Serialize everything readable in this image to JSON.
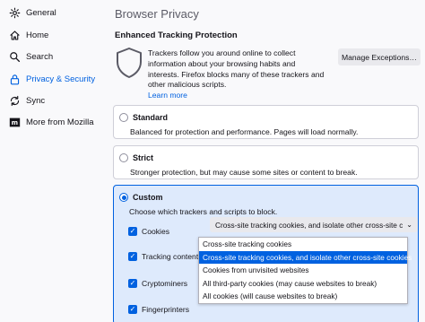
{
  "sidebar": {
    "items": [
      {
        "label": "General",
        "icon": "gear-icon"
      },
      {
        "label": "Home",
        "icon": "home-icon"
      },
      {
        "label": "Search",
        "icon": "search-icon"
      },
      {
        "label": "Privacy & Security",
        "icon": "lock-icon",
        "active": true
      },
      {
        "label": "Sync",
        "icon": "sync-icon"
      },
      {
        "label": "More from Mozilla",
        "icon": "mozilla-icon"
      }
    ]
  },
  "main": {
    "page_title": "Browser Privacy",
    "section_title": "Enhanced Tracking Protection",
    "etp_description": "Trackers follow you around online to collect information about your browsing habits and interests. Firefox blocks many of these trackers and other malicious scripts.",
    "learn_more": "Learn more",
    "manage_exceptions": "Manage Exceptions…"
  },
  "options": {
    "standard": {
      "label": "Standard",
      "description": "Balanced for protection and performance. Pages will load normally."
    },
    "strict": {
      "label": "Strict",
      "description": "Stronger protection, but may cause some sites or content to break."
    },
    "custom": {
      "label": "Custom",
      "description": "Choose which trackers and scripts to block.",
      "checks": [
        {
          "label": "Cookies",
          "checked": true
        },
        {
          "label": "Tracking content",
          "checked": true
        },
        {
          "label": "Cryptominers",
          "checked": true
        },
        {
          "label": "Fingerprinters",
          "checked": true
        }
      ]
    }
  },
  "cookies_dropdown": {
    "selected": "Cross-site tracking cookies, and isolate other cross-site c...",
    "options": [
      "Cross-site tracking cookies",
      "Cross-site tracking cookies, and isolate other cross-site cookies",
      "Cookies from unvisited websites",
      "All third-party cookies (may cause websites to break)",
      "All cookies (will cause websites to break)"
    ],
    "highlighted_index": 1
  },
  "colors": {
    "accent": "#0061e0",
    "selected_bg": "#deeafc"
  }
}
